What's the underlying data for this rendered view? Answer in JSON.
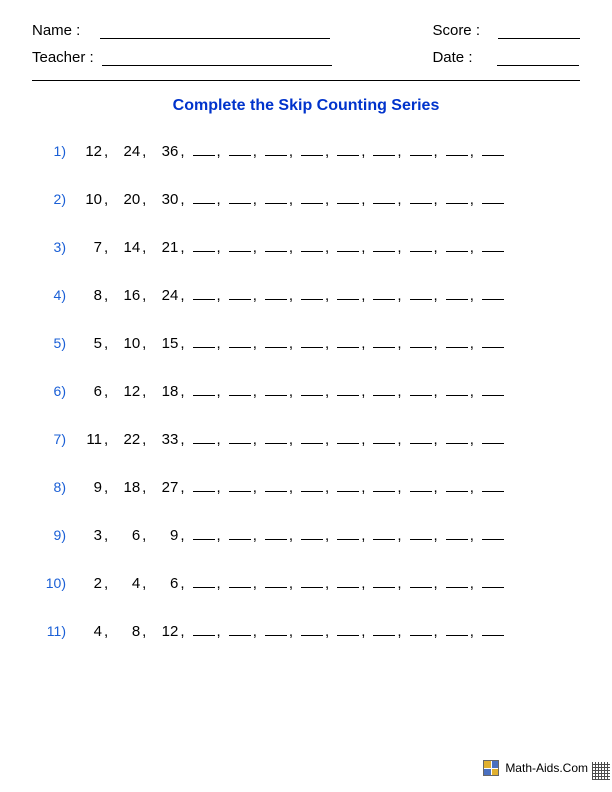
{
  "header": {
    "name_label": "Name :",
    "teacher_label": "Teacher :",
    "score_label": "Score :",
    "date_label": "Date :"
  },
  "title": "Complete the Skip Counting Series",
  "problems": [
    {
      "n": "1)",
      "given": [
        "12",
        "24",
        "36"
      ],
      "blanks": 9
    },
    {
      "n": "2)",
      "given": [
        "10",
        "20",
        "30"
      ],
      "blanks": 9
    },
    {
      "n": "3)",
      "given": [
        "7",
        "14",
        "21"
      ],
      "blanks": 9
    },
    {
      "n": "4)",
      "given": [
        "8",
        "16",
        "24"
      ],
      "blanks": 9
    },
    {
      "n": "5)",
      "given": [
        "5",
        "10",
        "15"
      ],
      "blanks": 9
    },
    {
      "n": "6)",
      "given": [
        "6",
        "12",
        "18"
      ],
      "blanks": 9
    },
    {
      "n": "7)",
      "given": [
        "11",
        "22",
        "33"
      ],
      "blanks": 9
    },
    {
      "n": "8)",
      "given": [
        "9",
        "18",
        "27"
      ],
      "blanks": 9
    },
    {
      "n": "9)",
      "given": [
        "3",
        "6",
        "9"
      ],
      "blanks": 9
    },
    {
      "n": "10)",
      "given": [
        "2",
        "4",
        "6"
      ],
      "blanks": 9
    },
    {
      "n": "11)",
      "given": [
        "4",
        "8",
        "12"
      ],
      "blanks": 9
    }
  ],
  "footer": {
    "brand": "Math-Aids.Com"
  }
}
